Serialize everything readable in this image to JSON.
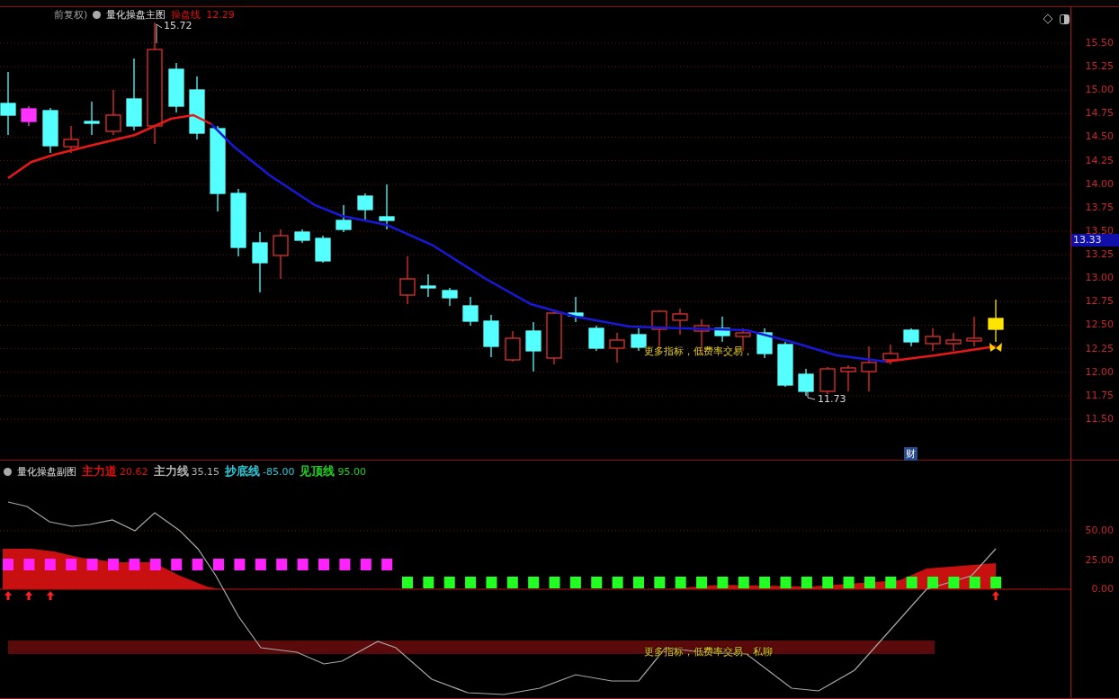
{
  "main_chart": {
    "adjust_label": "前复权)",
    "title": "量化操盘主图",
    "indicator": {
      "name": "操盘线",
      "value": "12.29"
    },
    "y_axis": [
      "15.50",
      "15.25",
      "15.00",
      "14.75",
      "14.50",
      "14.25",
      "14.00",
      "13.75",
      "13.50",
      "13.25",
      "13.00",
      "12.75",
      "12.50",
      "12.25",
      "12.00",
      "11.75",
      "11.50"
    ],
    "last_price": "13.33",
    "high_label": "15.72",
    "low_label": "11.73",
    "overlay_text": "更多指标，低费率交易，",
    "finance_marker": "财"
  },
  "sub_chart": {
    "title": "量化操盘副图",
    "indicators": [
      {
        "name": "主力道",
        "value": "20.62",
        "color": "#e01010"
      },
      {
        "name": "主力线",
        "value": "35.15",
        "color": "#b4b4b4"
      },
      {
        "name": "抄底线",
        "value": "-85.00",
        "color": "#2ec8d8"
      },
      {
        "name": "见顶线",
        "value": "95.00",
        "color": "#22d022"
      }
    ],
    "y_axis": [
      "50.00",
      "25.00",
      "0.00"
    ],
    "overlay_text": "更多指标，低费率交易，私聊"
  }
}
